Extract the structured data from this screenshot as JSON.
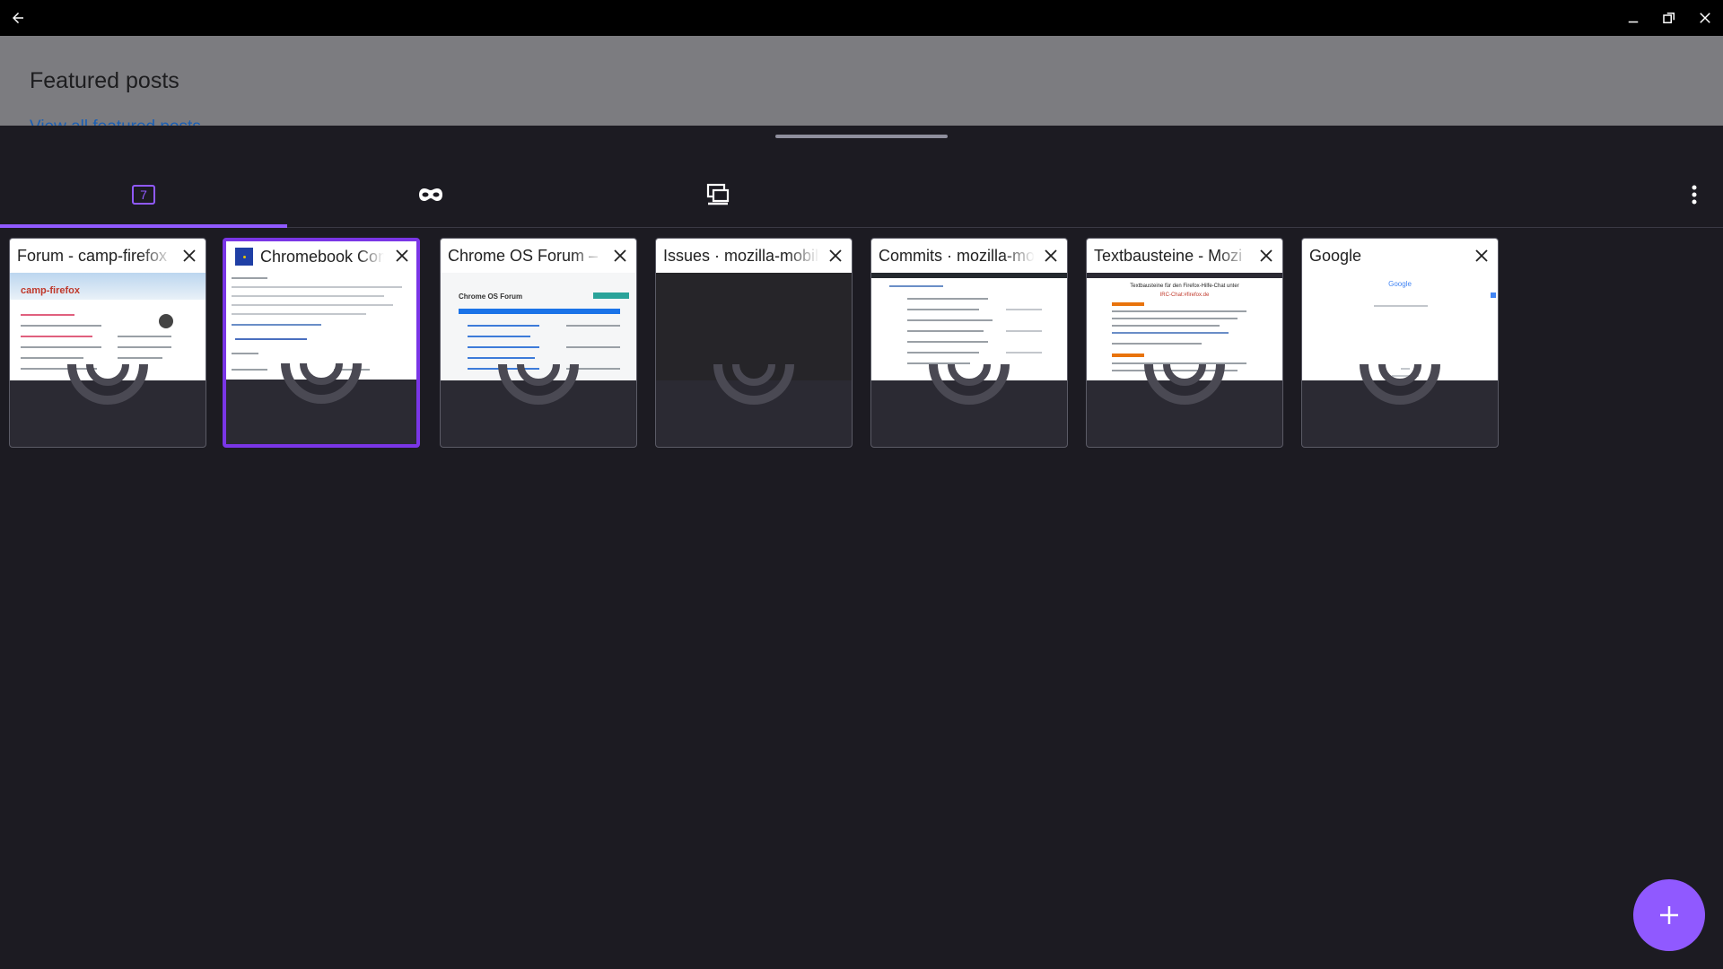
{
  "window": {
    "back_icon": "arrow-left-icon",
    "minimize_icon": "minimize-icon",
    "maximize_icon": "restore-icon",
    "close_icon": "close-icon"
  },
  "background_page": {
    "title": "Featured posts",
    "link": "View all featured posts"
  },
  "tab_tray": {
    "segments": [
      {
        "name": "normal-tabs",
        "count": "7",
        "selected": true
      },
      {
        "name": "private-tabs",
        "icon": "mask-icon"
      },
      {
        "name": "synced-tabs",
        "icon": "synced-devices-icon"
      }
    ],
    "menu_icon": "more-vert-icon",
    "tabs": [
      {
        "title": "Forum - camp-firefox",
        "selected": false,
        "has_favicon": false
      },
      {
        "title": "Chromebook Com",
        "selected": true,
        "has_favicon": true
      },
      {
        "title": "Chrome OS Forum – ",
        "selected": false,
        "has_favicon": false
      },
      {
        "title": "Issues · mozilla-mobil",
        "selected": false,
        "has_favicon": false
      },
      {
        "title": "Commits · mozilla-mo",
        "selected": false,
        "has_favicon": false
      },
      {
        "title": "Textbausteine - Mozi",
        "selected": false,
        "has_favicon": false
      },
      {
        "title": "Google",
        "selected": false,
        "has_favicon": false
      }
    ],
    "thumb_texts": {
      "camp": "camp-firefox",
      "chromeos": "Chrome OS Forum",
      "textbausteine_title": "Textbausteine für den Firefox-Hilfe-Chat unter",
      "textbausteine_sub": "IRC-Chat:#firefox.de",
      "google": "Google"
    },
    "new_tab_icon": "plus-icon",
    "accent_color": "#9059ff"
  }
}
